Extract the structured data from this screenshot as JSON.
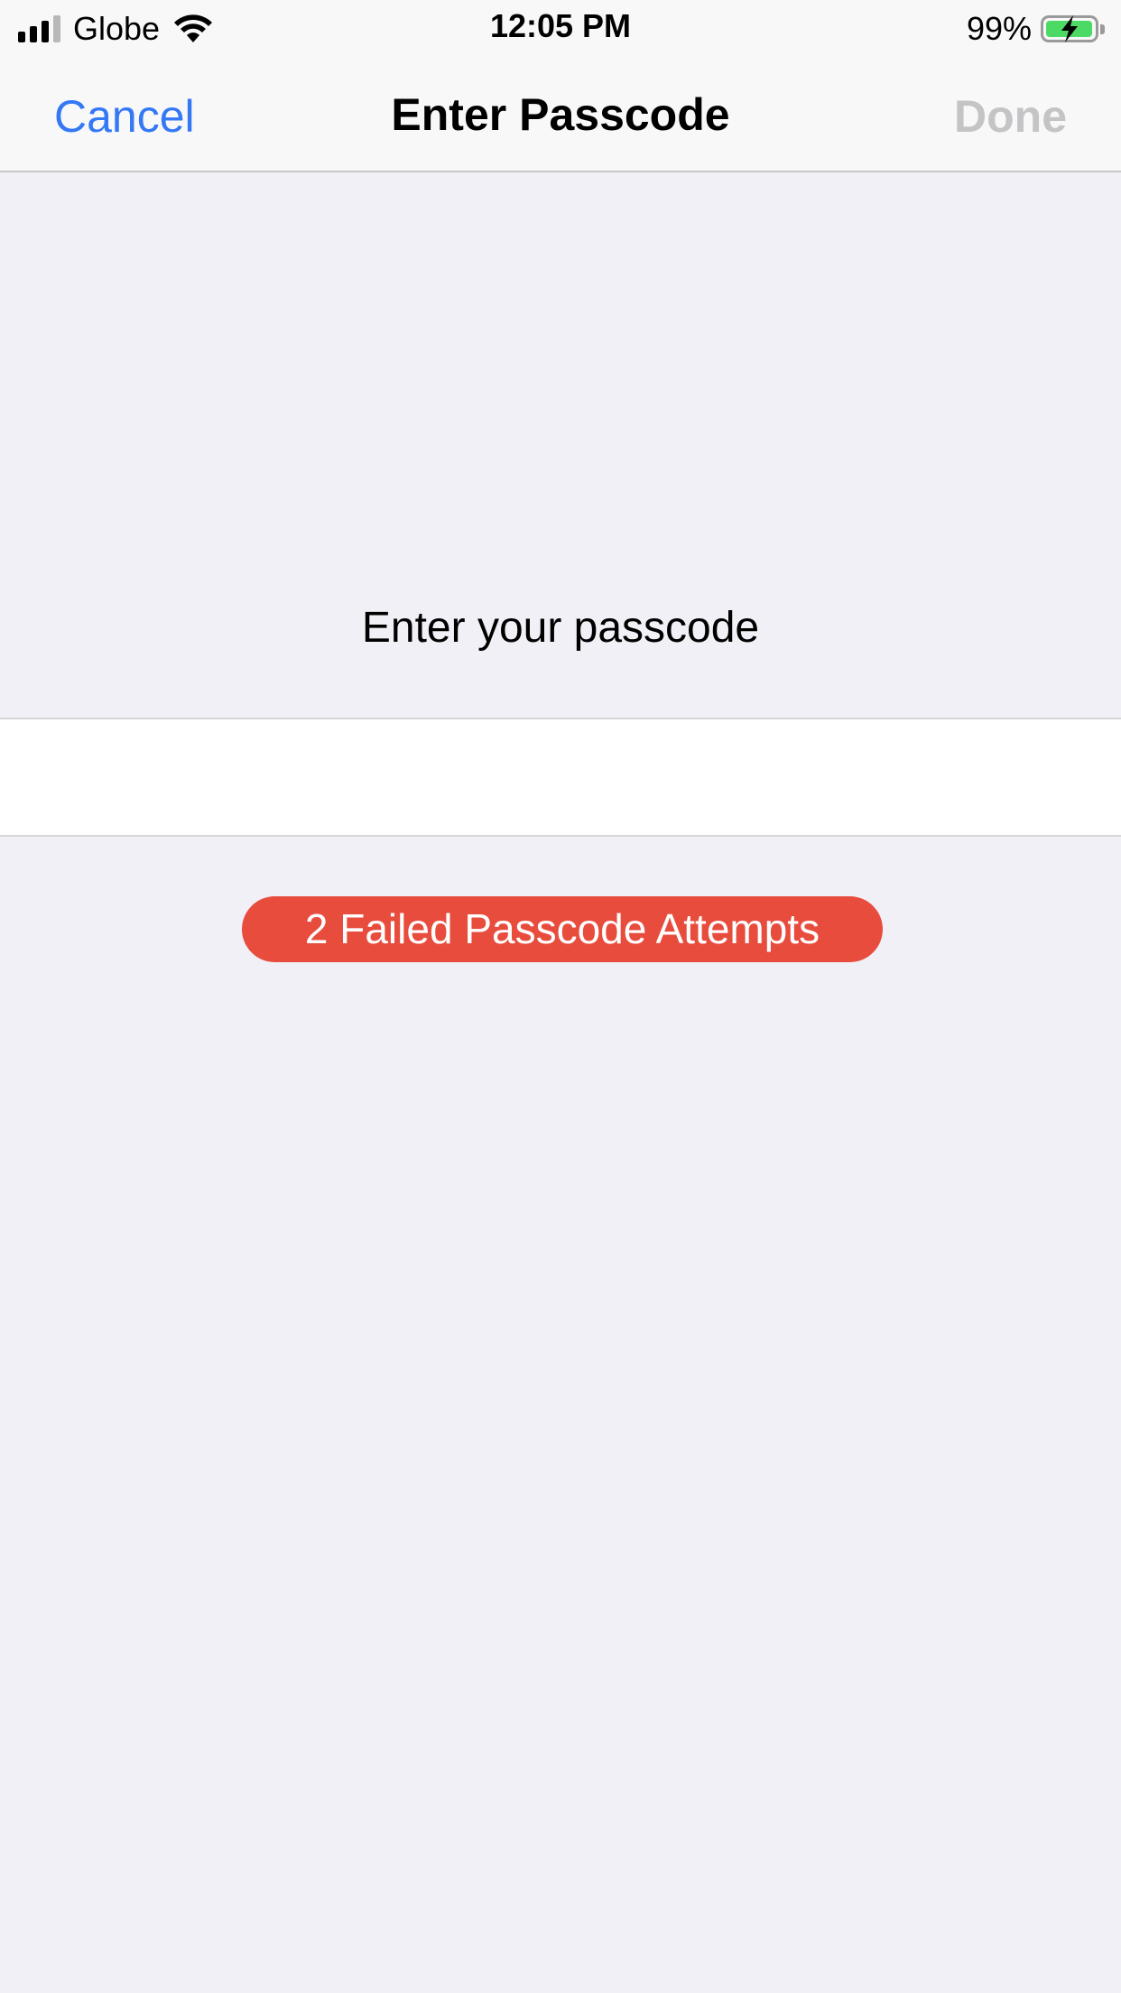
{
  "status_bar": {
    "carrier": "Globe",
    "time": "12:05 PM",
    "battery_percent": "99%",
    "battery_level": 0.99,
    "charging": true,
    "signal_bars_active": 3,
    "signal_bars_total": 4,
    "icons": [
      "cellular-signal-icon",
      "wifi-icon",
      "battery-charging-icon"
    ]
  },
  "nav": {
    "cancel_label": "Cancel",
    "title": "Enter Passcode",
    "done_label": "Done"
  },
  "main": {
    "prompt": "Enter your passcode",
    "passcode_value": "",
    "failed_attempts_text": "2 Failed Passcode Attempts"
  },
  "colors": {
    "accent": "#3478f6",
    "disabled": "#c4c4c6",
    "error_badge": "#e84c3d",
    "background": "#f0f0f6",
    "battery_fill": "#4cd964"
  }
}
